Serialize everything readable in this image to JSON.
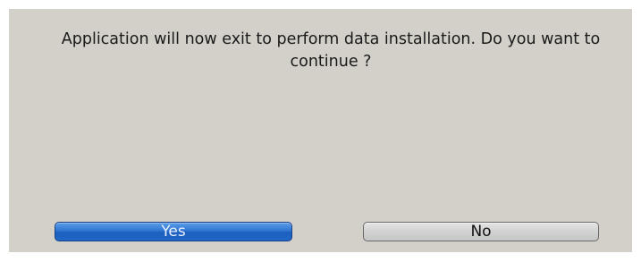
{
  "dialog": {
    "message": "Application will now exit to perform data installation. Do you want to continue ?",
    "buttons": {
      "yes_label": "Yes",
      "no_label": "No"
    }
  },
  "colors": {
    "dialog_background": "#d3d0c9",
    "selected_button": "#2f76d1",
    "unselected_button": "#d2d2d2"
  }
}
